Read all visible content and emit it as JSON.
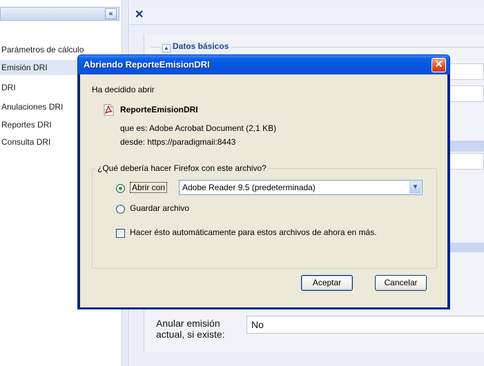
{
  "sidebar": {
    "collapse_label": "«",
    "items": [
      {
        "label": "Parámetros de cálculo",
        "active": false
      },
      {
        "label": "Emisión DRI",
        "active": true
      },
      {
        "label": "DRI",
        "active": false
      },
      {
        "label": "Anulaciones DRI",
        "active": false
      },
      {
        "label": "Reportes DRI",
        "active": false
      },
      {
        "label": "Consulta DRI",
        "active": false
      }
    ]
  },
  "main": {
    "close_icon": "✕",
    "fieldset_title": "Datos básicos",
    "anular_label": "Anular emisión actual, si existe:",
    "anular_value": "No"
  },
  "dialog": {
    "title": "Abriendo ReporteEmisionDRI",
    "close_glyph": "✕",
    "decided_text": "Ha decidido abrir",
    "file_name": "ReporteEmisionDRI",
    "type_key": "que es:",
    "type_value": "Adobe Acrobat Document (2,1 KB)",
    "from_key": "desde:",
    "from_value": "https://paradigmaii:8443",
    "question": "¿Qué debería hacer Firefox con este archivo?",
    "open_with_label": "Abrir con",
    "open_with_app": "Adobe Reader 9.5 (predeterminada)",
    "save_label": "Guardar archivo",
    "auto_label": "Hacer ésto automáticamente para estos archivos de ahora en más.",
    "ok_label": "Aceptar",
    "cancel_label": "Cancelar",
    "selected_option": "Abrir con",
    "auto_checked": false
  },
  "colors": {
    "titlebar": "#0556de",
    "dialog_body": "#ece9d8",
    "accent_blue": "#1e4596"
  }
}
